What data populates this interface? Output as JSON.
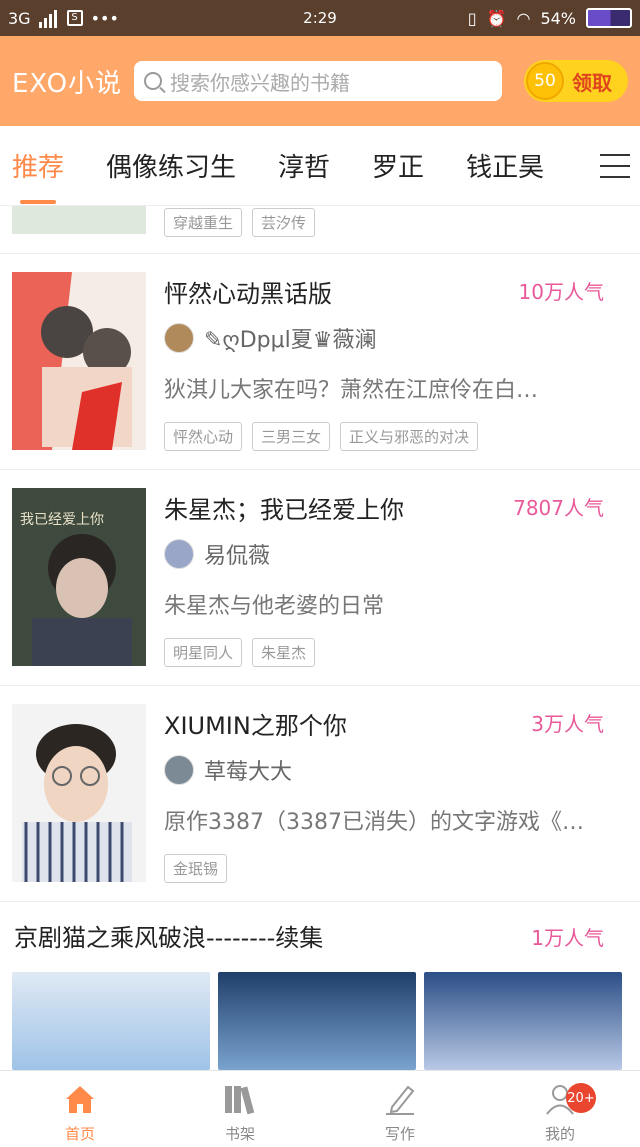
{
  "status": {
    "network": "3G",
    "time": "2:29",
    "battery": "54%"
  },
  "header": {
    "logo": "EXO小说",
    "search_placeholder": "搜索你感兴趣的书籍",
    "claim_coins": "50",
    "claim_label": "领取"
  },
  "tabs": [
    {
      "label": "推荐",
      "active": true
    },
    {
      "label": "偶像练习生"
    },
    {
      "label": "淳哲"
    },
    {
      "label": "罗正"
    },
    {
      "label": "钱正昊"
    }
  ],
  "partial_tags": [
    "穿越重生",
    "芸汐传"
  ],
  "books": [
    {
      "title": "怦然心动黑话版",
      "popularity": "10万人气",
      "author": "✎ღDpμl夏♛薇澜",
      "desc": "狄淇儿大家在吗？萧然在江庶伶在白…",
      "tags": [
        "怦然心动",
        "三男三女",
        "正义与邪恶的对决"
      ]
    },
    {
      "title": "朱星杰；我已经爱上你",
      "popularity": "7807人气",
      "author": "易侃薇",
      "desc": "朱星杰与他老婆的日常",
      "tags": [
        "明星同人",
        "朱星杰"
      ]
    },
    {
      "title": "XIUMIN之那个你",
      "popularity": "3万人气",
      "author": "草莓大大",
      "desc": "原作3387（3387已消失）的文字游戏《…",
      "tags": [
        "金珉锡"
      ]
    }
  ],
  "section": {
    "title": "京剧猫之乘风破浪--------续集",
    "popularity": "1万人气"
  },
  "nav": [
    {
      "label": "首页",
      "icon": "home-icon",
      "active": true
    },
    {
      "label": "书架",
      "icon": "bookshelf-icon"
    },
    {
      "label": "写作",
      "icon": "pencil-icon"
    },
    {
      "label": "我的",
      "icon": "user-icon",
      "badge": "20+"
    }
  ]
}
